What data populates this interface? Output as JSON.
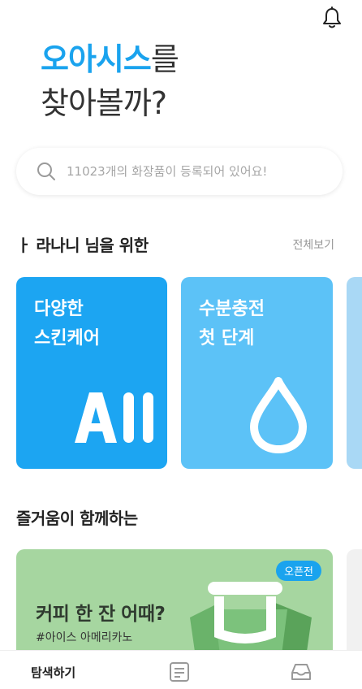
{
  "header": {
    "bell_icon": "bell-icon"
  },
  "hero": {
    "brand": "오아시스",
    "line1_suffix": "를",
    "line2": "찾아볼까?"
  },
  "search": {
    "placeholder": "11023개의 화장품이 등록되어 있어요!",
    "icon": "search-icon"
  },
  "section_recommend": {
    "title": "ㅏ 라나니 님을 위한",
    "see_all": "전체보기",
    "cards": [
      {
        "line1": "다양한",
        "line2": "스킨케어",
        "art": "All",
        "color": "#1ca5f2"
      },
      {
        "line1": "수분충전",
        "line2": "첫 단계",
        "art": "water-drop-icon",
        "color": "#5cc2f7"
      }
    ]
  },
  "section_fun": {
    "title": "즐거움이 함께하는",
    "promo": {
      "badge": "오픈전",
      "title": "커피 한 잔 어때?",
      "tag": "#아이스 아메리카노"
    }
  },
  "tabbar": {
    "explore": "탐색하기",
    "feed_icon": "feed-icon",
    "inbox_icon": "inbox-icon"
  }
}
